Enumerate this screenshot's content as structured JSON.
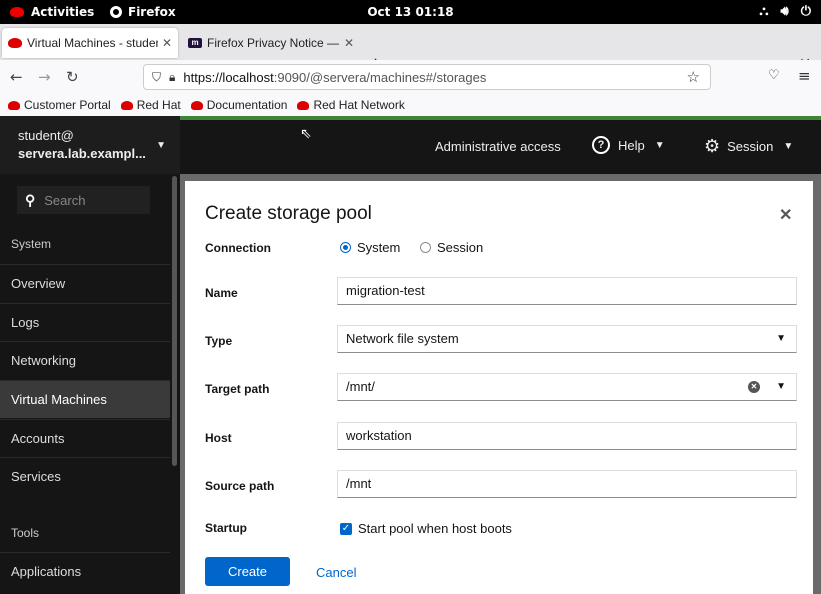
{
  "topbar": {
    "activities": "Activities",
    "app": "Firefox",
    "clock": "Oct 13  01:18"
  },
  "browser": {
    "tabs": [
      {
        "title": "Virtual Machines - studen",
        "favicon": "redhat-icon"
      },
      {
        "title": "Firefox Privacy Notice — F",
        "favicon": "mozilla-icon"
      }
    ],
    "url_host": "https://localhost",
    "url_rest": ":9090/@servera/machines#/storages",
    "bookmarks": [
      "Customer Portal",
      "Red Hat",
      "Documentation",
      "Red Hat Network"
    ]
  },
  "cockpit": {
    "user": "student@",
    "host": "servera.lab.exampl...",
    "search_placeholder": "Search",
    "header": {
      "admin": "Administrative access",
      "help": "Help",
      "session": "Session"
    },
    "nav_groups": [
      "System",
      "Tools"
    ],
    "nav_items": [
      "Overview",
      "Logs",
      "Networking",
      "Virtual Machines",
      "Accounts",
      "Services",
      "Applications"
    ],
    "active_item": "Virtual Machines"
  },
  "dialog": {
    "title": "Create storage pool",
    "labels": {
      "connection": "Connection",
      "name": "Name",
      "type": "Type",
      "target_path": "Target path",
      "host": "Host",
      "source_path": "Source path",
      "startup": "Startup"
    },
    "connection_options": [
      "System",
      "Session"
    ],
    "connection_selected": "System",
    "values": {
      "name": "migration-test",
      "type": "Network file system",
      "target_path": "/mnt/",
      "host": "workstation",
      "source_path": "/mnt"
    },
    "startup_label": "Start pool when host boots",
    "startup_checked": true,
    "create": "Create",
    "cancel": "Cancel"
  },
  "colors": {
    "accent": "#0066cc",
    "header_bg": "#151515",
    "green_bar": "#3e8635"
  }
}
